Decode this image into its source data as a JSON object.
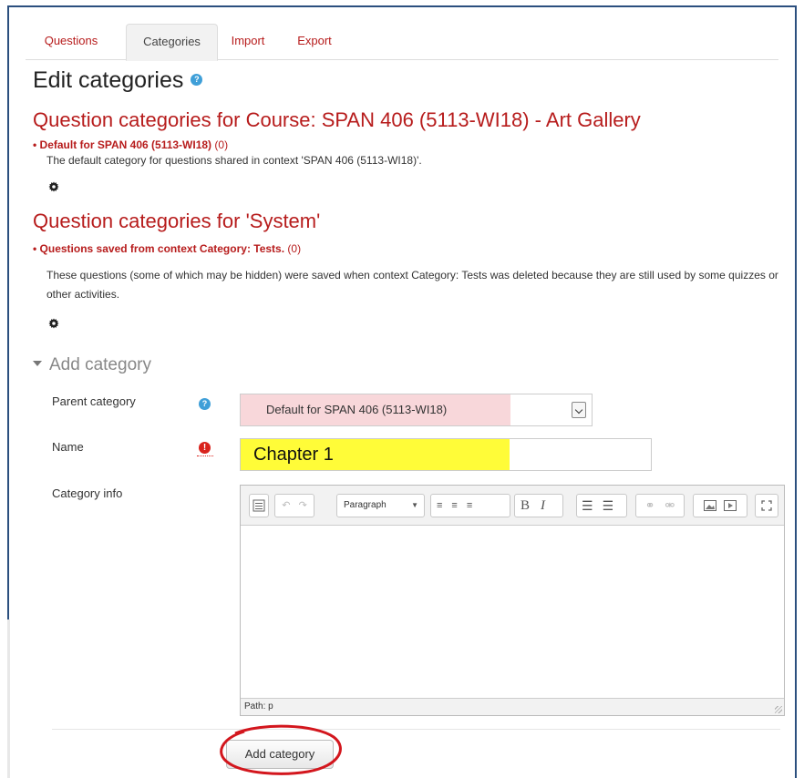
{
  "tabs": [
    {
      "label": "Questions",
      "active": false
    },
    {
      "label": "Categories",
      "active": true
    },
    {
      "label": "Import",
      "active": false
    },
    {
      "label": "Export",
      "active": false
    }
  ],
  "page_title": "Edit categories",
  "sections": [
    {
      "heading": "Question categories for  Course: SPAN 406 (5113-WI18) - Art Gallery",
      "category_name": "Default for SPAN 406 (5113-WI18)",
      "category_count": "(0)",
      "description": "The default category for questions shared in context 'SPAN 406 (5113-WI18)'."
    },
    {
      "heading": "Question categories for 'System'",
      "category_name": "Questions saved from context Category: Tests.",
      "category_count": "(0)",
      "description": "These questions (some of which may be hidden) were saved when context Category: Tests was deleted because they are still used by some quizzes or other activities."
    }
  ],
  "add_category": {
    "heading": "Add category",
    "parent_label": "Parent category",
    "parent_value": "Default for SPAN 406 (5113-WI18)",
    "name_label": "Name",
    "name_value": "Chapter 1",
    "info_label": "Category info",
    "editor": {
      "format_value": "Paragraph",
      "path_text": "Path: p"
    },
    "submit_label": "Add category"
  },
  "colors": {
    "link_red": "#b71c1c",
    "help_blue": "#3f9fd8",
    "required_red": "#d9221c",
    "name_highlight": "#fffc38",
    "parent_highlight": "#f8d7da",
    "annotation_circle": "#d3161d"
  }
}
